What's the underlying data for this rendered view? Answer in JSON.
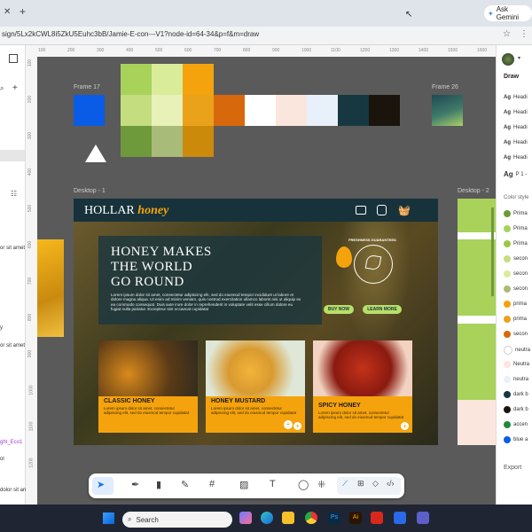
{
  "browser": {
    "tab_new_symbol": "+",
    "url": "sign/5Lx2kCWL8i5ZkU5Euhc3bB/Jamie-E-con---V1?node-id=64-34&p=f&m=draw",
    "gemini_label": "Ask Gemini"
  },
  "left_panel": {
    "plus": "+",
    "texts": [
      "or sit amet",
      "y",
      "or sit amet",
      "ght_Eco1",
      "ol",
      "dolor sit amet"
    ]
  },
  "rulers": {
    "top": [
      "100",
      "200",
      "300",
      "400",
      "500",
      "600",
      "700",
      "800",
      "900",
      "1000",
      "1100",
      "1200",
      "1300",
      "1400",
      "1500",
      "1600"
    ],
    "left": [
      "100",
      "200",
      "300",
      "400",
      "500",
      "600",
      "700",
      "800",
      "900",
      "1000",
      "1100",
      "1200"
    ]
  },
  "canvas": {
    "frame17_label": "Frame 17",
    "frame26_label": "Frame 26",
    "desktop1_label": "Desktop - 1",
    "desktop2_label": "Desktop - 2",
    "swatch_colors": {
      "blue": "#0a5ce6",
      "grid": [
        "#a8d25a",
        "#d9ec9a",
        "#f5a30d",
        "#c4dd7f",
        "#e8f1b7",
        "#e9a21a",
        "#6e9a3c",
        "#a9bb78",
        "#cc8a0b"
      ],
      "strip": [
        "#d8680c",
        "#ffffff",
        "#fbe6dd",
        "#e8f0fa",
        "#173840",
        "#1a140d"
      ]
    }
  },
  "site": {
    "brand_a": "HOLLAR",
    "brand_b": "honey",
    "hero_title_1": "HONEY MAKES",
    "hero_title_2": "THE WORLD",
    "hero_title_3": "GO ROUND",
    "hero_body": "Lorem ipsum dolor sit amet, consectetur adipiscing elit, sed do eiusmod tempor incididunt ut labore et dolore magna aliqua. Ut enim ad minim veniam, quis nostrud exercitation ullamco laboris nisi ut aliquip ex ea commodo consequat. Duis aute irure dolor in reprehenderit in voluptate velit esse cillum dolore eu fugiat nulla pariatur. Excepteur sint occaecat cupidatat",
    "buy_now": "BUY NOW",
    "learn_more": "LEARN MORE",
    "seal_text": "FRESHNESS GUARANTEED",
    "products": [
      {
        "title": "CLASSIC HONEY",
        "text": "Lorem ipsum dolor sit amet, consectetur adipiscing elit, sed do eiusmod tempor cupidatat"
      },
      {
        "title": "HONEY MUSTARD",
        "text": "Lorem ipsum dolor sit amet, consectetur adipiscing elit, sed do eiusmod tempor cupidatat"
      },
      {
        "title": "SPICY HONEY",
        "text": "Lorem ipsum dolor sit amet, consectetur adipiscing elit, sed do eiusmod tempor cupidatat"
      }
    ]
  },
  "right_panel": {
    "draw_label": "Draw",
    "text_styles": [
      "Headi",
      "Headi",
      "Headi",
      "Headi",
      "Headi",
      "P 1 -"
    ],
    "ag": "Ag",
    "color_styles_label": "Color style",
    "colors": [
      {
        "name": "Prima",
        "color": "#6e9a3c"
      },
      {
        "name": "Prima",
        "color": "#a8d25a"
      },
      {
        "name": "Prima",
        "color": "#9dc648"
      },
      {
        "name": "secon",
        "color": "#c4dd7f"
      },
      {
        "name": "secon",
        "color": "#d9ec9a"
      },
      {
        "name": "secon",
        "color": "#a9bb78"
      },
      {
        "name": "prima",
        "color": "#f5a30d"
      },
      {
        "name": "prima",
        "color": "#e9a21a"
      },
      {
        "name": "secon",
        "color": "#d8680c"
      },
      {
        "name": "neutra",
        "color": "#ffffff"
      },
      {
        "name": "Neutra",
        "color": "#fbe6dd"
      },
      {
        "name": "neutra",
        "color": "#e8f0fa"
      },
      {
        "name": "dark b",
        "color": "#173840"
      },
      {
        "name": "dark b",
        "color": "#1a140d"
      },
      {
        "name": "accen",
        "color": "#1e8a3c"
      },
      {
        "name": "blue a",
        "color": "#0a5ce6"
      }
    ],
    "export_label": "Export"
  },
  "taskbar": {
    "search_label": "Search"
  }
}
